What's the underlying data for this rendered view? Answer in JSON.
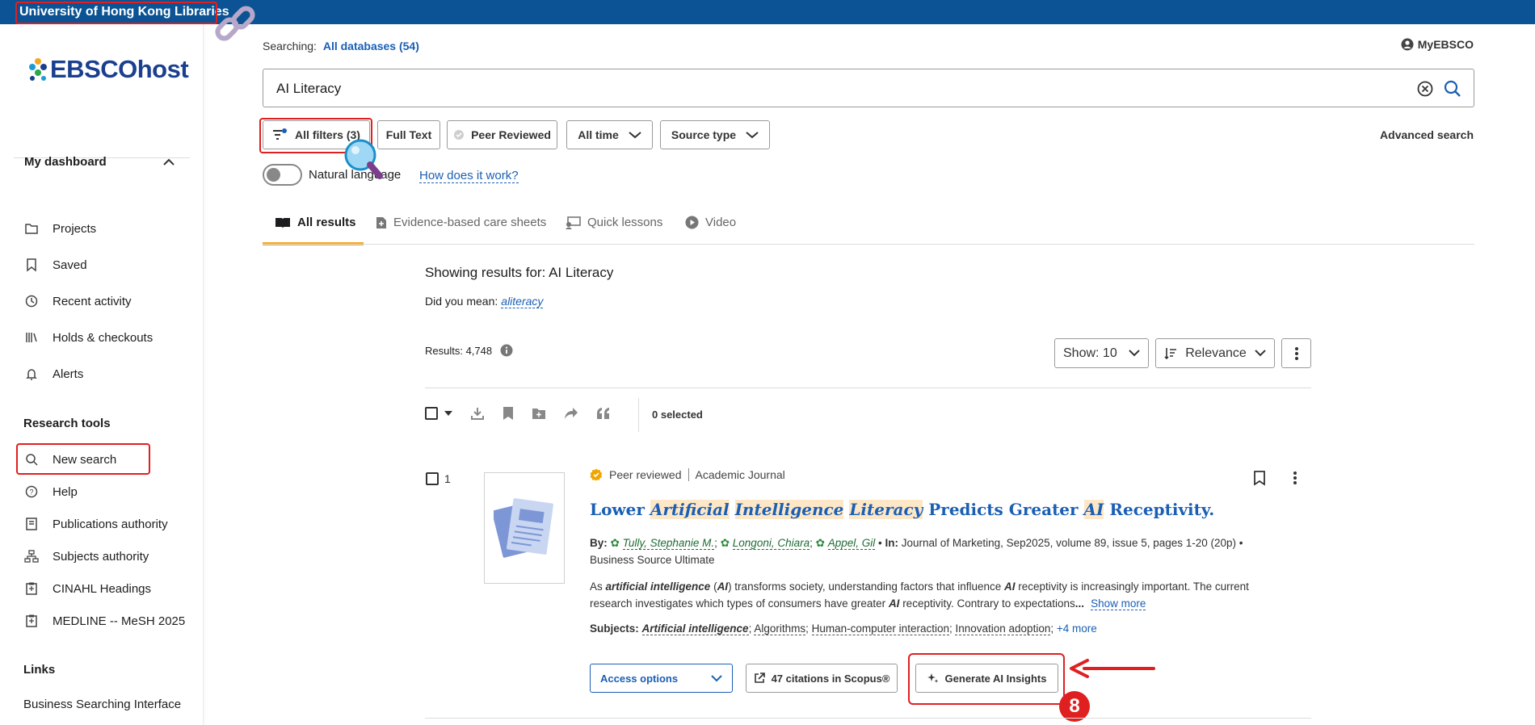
{
  "top_bar": {
    "institution": "University of Hong Kong Libraries"
  },
  "sidebar": {
    "logo": "EBSCOhost",
    "dashboard_title": "My dashboard",
    "dashboard_items": [
      "Projects",
      "Saved",
      "Recent activity",
      "Holds & checkouts",
      "Alerts"
    ],
    "research_title": "Research tools",
    "research_items": [
      "New search",
      "Help",
      "Publications authority",
      "Subjects authority",
      "CINAHL Headings",
      "MEDLINE -- MeSH 2025"
    ],
    "links_title": "Links",
    "links_items": [
      "Business Searching Interface"
    ]
  },
  "header": {
    "searching_label": "Searching:",
    "databases": "All databases (54)",
    "myebsco": "MyEBSCO"
  },
  "search": {
    "query": "AI Literacy"
  },
  "filters": {
    "all_filters": "All filters (3)",
    "full_text": "Full Text",
    "peer_reviewed": "Peer Reviewed",
    "all_time": "All time",
    "source_type": "Source type",
    "advanced_search": "Advanced search",
    "natural_language": "Natural language",
    "how_link": "How does it work?"
  },
  "tabs": [
    "All results",
    "Evidence-based care sheets",
    "Quick lessons",
    "Video"
  ],
  "results": {
    "showing": "Showing results for: AI Literacy",
    "did_you_mean_label": "Did you mean:",
    "did_you_mean": "aliteracy",
    "count": "Results: 4,748",
    "show": "Show: 10",
    "sort": "Relevance",
    "selected": "0 selected"
  },
  "record": {
    "rank": "1",
    "peer_reviewed": "Peer reviewed",
    "type": "Academic Journal",
    "title_parts": [
      "Lower ",
      "Artificial",
      " ",
      "Intelligence",
      " ",
      "Literacy",
      " Predicts Greater ",
      "AI",
      " Receptivity."
    ],
    "by_label": "By:",
    "authors": [
      "Tully, Stephanie M.",
      "Longoni, Chiara",
      "Appel, Gil"
    ],
    "in_label": "In:",
    "source": "Journal of Marketing, Sep2025, volume 89, issue 5, pages 1-20 (20p)",
    "database": "Business Source Ultimate",
    "abstract_parts": [
      "As ",
      "artificial intelligence",
      " (",
      "AI",
      ") transforms society, understanding factors that influence ",
      "AI",
      " receptivity is increasingly important. The current research investigates which types of consumers have greater ",
      "AI",
      " receptivity. Contrary to expectations"
    ],
    "ellipsis": "...",
    "show_more": "Show more",
    "subjects_label": "Subjects:",
    "subjects": [
      "Artificial intelligence",
      "Algorithms",
      "Human-computer interaction",
      "Innovation adoption"
    ],
    "more_subjects": "+4 more",
    "access_options": "Access options",
    "citations": "47 citations in Scopus®",
    "generate_ai": "Generate AI Insights"
  },
  "annotation": {
    "step": "8"
  }
}
